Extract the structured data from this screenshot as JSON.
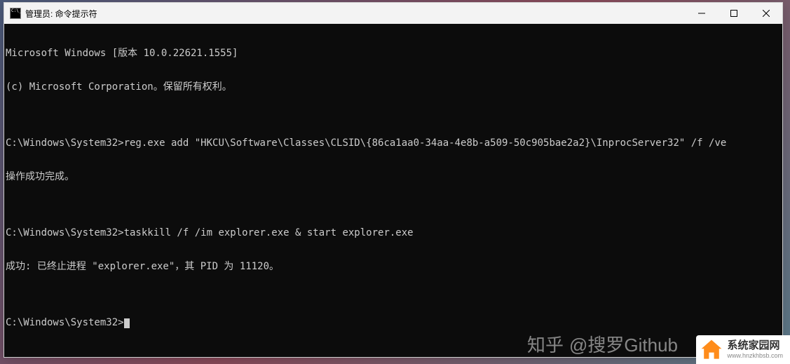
{
  "window": {
    "title": "管理员: 命令提示符"
  },
  "terminal": {
    "banner1": "Microsoft Windows [版本 10.0.22621.1555]",
    "banner2": "(c) Microsoft Corporation。保留所有权利。",
    "blank1": "",
    "prompt1": "C:\\Windows\\System32>",
    "cmd1": "reg.exe add \"HKCU\\Software\\Classes\\CLSID\\{86ca1aa0-34aa-4e8b-a509-50c905bae2a2}\\InprocServer32\" /f /ve",
    "result1": "操作成功完成。",
    "blank2": "",
    "prompt2": "C:\\Windows\\System32>",
    "cmd2": "taskkill /f /im explorer.exe & start explorer.exe",
    "result2": "成功: 已终止进程 \"explorer.exe\"，其 PID 为 11120。",
    "blank3": "",
    "prompt3": "C:\\Windows\\System32>"
  },
  "watermark": {
    "zhihu_prefix": "知乎",
    "zhihu_author": "@搜罗Github",
    "site_name": "系统家园网",
    "site_url": "www.hnzkhbsb.com"
  }
}
